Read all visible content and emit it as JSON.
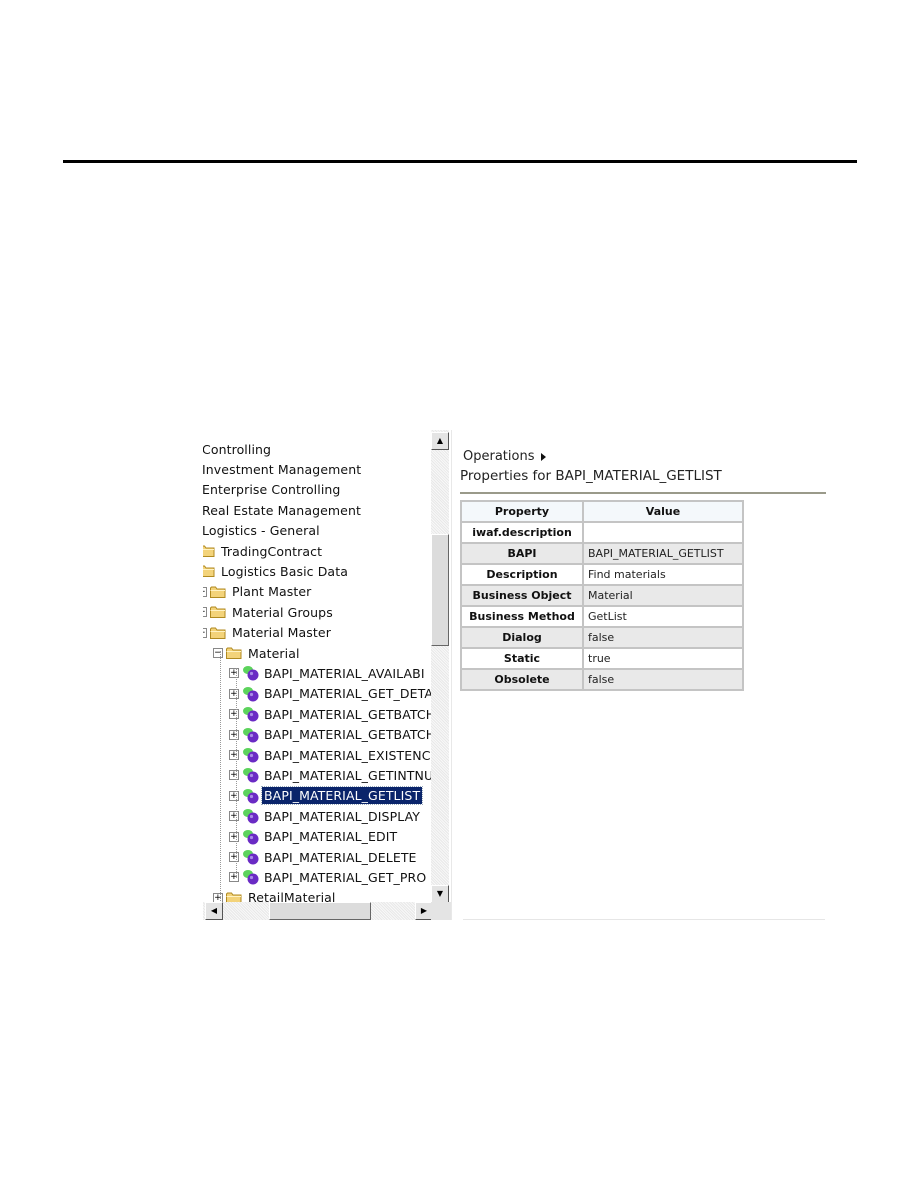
{
  "tree": {
    "items": [
      {
        "label": "Controlling",
        "level": 0,
        "icon": "none"
      },
      {
        "label": "Investment Management",
        "level": 0,
        "icon": "none"
      },
      {
        "label": "Enterprise Controlling",
        "level": 0,
        "icon": "none"
      },
      {
        "label": "Real Estate Management",
        "level": 0,
        "icon": "none"
      },
      {
        "label": "Logistics - General",
        "level": 0,
        "icon": "none"
      },
      {
        "label": "TradingContract",
        "level": 1,
        "icon": "folder-icon"
      },
      {
        "label": "Logistics Basic Data",
        "level": 1,
        "icon": "folder-icon"
      },
      {
        "label": "Plant Master",
        "level": 2,
        "icon": "folder-icon"
      },
      {
        "label": "Material Groups",
        "level": 2,
        "icon": "folder-icon"
      },
      {
        "label": "Material Master",
        "level": 2,
        "icon": "folder-icon"
      },
      {
        "label": "Material",
        "level": 3,
        "icon": "folder-icon"
      },
      {
        "label": "BAPI_MATERIAL_AVAILABI",
        "level": 4,
        "icon": "method-icon"
      },
      {
        "label": "BAPI_MATERIAL_GET_DETA",
        "level": 4,
        "icon": "method-icon"
      },
      {
        "label": "BAPI_MATERIAL_GETBATCH",
        "level": 4,
        "icon": "method-icon"
      },
      {
        "label": "BAPI_MATERIAL_GETBATCH",
        "level": 4,
        "icon": "method-icon"
      },
      {
        "label": "BAPI_MATERIAL_EXISTENC",
        "level": 4,
        "icon": "method-icon"
      },
      {
        "label": "BAPI_MATERIAL_GETINTNU",
        "level": 4,
        "icon": "method-icon"
      },
      {
        "label": "BAPI_MATERIAL_GETLIST",
        "level": 4,
        "icon": "method-icon",
        "selected": true
      },
      {
        "label": "BAPI_MATERIAL_DISPLAY",
        "level": 4,
        "icon": "method-icon"
      },
      {
        "label": "BAPI_MATERIAL_EDIT",
        "level": 4,
        "icon": "method-icon"
      },
      {
        "label": "BAPI_MATERIAL_DELETE",
        "level": 4,
        "icon": "method-icon"
      },
      {
        "label": "BAPI_MATERIAL_GET_PRO",
        "level": 4,
        "icon": "method-icon"
      },
      {
        "label": "RetailMaterial",
        "level": 3,
        "icon": "folder-icon"
      }
    ]
  },
  "details": {
    "breadcrumb": "Operations",
    "title": "Properties for BAPI_MATERIAL_GETLIST",
    "table": {
      "headers": [
        "Property",
        "Value"
      ],
      "rows": [
        {
          "property": "iwaf.description",
          "value": ""
        },
        {
          "property": "BAPI",
          "value": "BAPI_MATERIAL_GETLIST"
        },
        {
          "property": "Description",
          "value": "Find materials"
        },
        {
          "property": "Business Object",
          "value": "Material"
        },
        {
          "property": "Business Method",
          "value": "GetList"
        },
        {
          "property": "Dialog",
          "value": "false"
        },
        {
          "property": "Static",
          "value": "true"
        },
        {
          "property": "Obsolete",
          "value": "false"
        }
      ]
    }
  },
  "colors": {
    "selection": "#0a246a",
    "folder": "#f3d37a",
    "method_green": "#5cd35c",
    "method_purple": "#6a2bc4"
  }
}
